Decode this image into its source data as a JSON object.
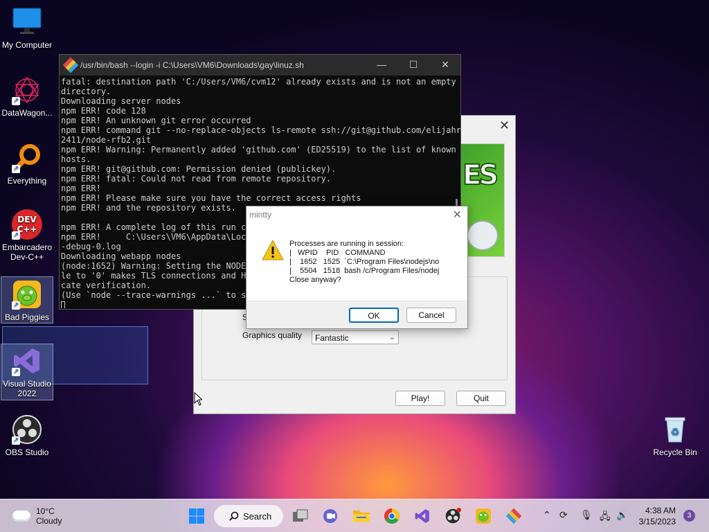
{
  "desktop": {
    "icons": [
      {
        "label": "My Computer"
      },
      {
        "label": "DataWagon..."
      },
      {
        "label": "Everything"
      },
      {
        "label": "Embarcadero Dev-C++"
      },
      {
        "label": "Bad Piggies"
      },
      {
        "label": "Visual Studio 2022"
      },
      {
        "label": "OBS Studio"
      },
      {
        "label": "Recycle Bin"
      }
    ],
    "devcpp_logo_text": "DEV C++"
  },
  "terminal": {
    "title": "/usr/bin/bash --login -i C:\\Users\\VM6\\Downloads\\gay\\linuz.sh",
    "lines": [
      "fatal: destination path 'C:/Users/VM6/cvm12' already exists and is not an empty",
      "directory.",
      "Downloading server nodes",
      "npm ERR! code 128",
      "npm ERR! An unknown git error occurred",
      "npm ERR! command git --no-replace-objects ls-remote ssh://git@github.com/elijahr",
      "2411/node-rfb2.git",
      "npm ERR! Warning: Permanently added 'github.com' (ED25519) to the list of known",
      "hosts.",
      "npm ERR! git@github.com: Permission denied (publickey).",
      "npm ERR! fatal: Could not read from remote repository.",
      "npm ERR!",
      "npm ERR! Please make sure you have the correct access rights",
      "npm ERR! and the repository exists.",
      "",
      "npm ERR! A complete log of this run can",
      "npm ERR!     C:\\Users\\VM6\\AppData\\Loca",
      "-debug-0.log",
      "Downloading webapp nodes",
      "(node:1652) Warning: Setting the NODE_T",
      "le to '0' makes TLS connections and HT",
      "cate verification.",
      "(Use `node --trace-warnings ...` to sho"
    ],
    "cursor_line": ""
  },
  "launcher": {
    "banner_text": "ES",
    "s_label": "S",
    "graphics_quality_label": "Graphics quality",
    "graphics_quality_value": "Fantastic",
    "play_label": "Play!",
    "quit_label": "Quit"
  },
  "dialog": {
    "title": "mintty",
    "message": "Processes are running in session:\n|   WPID    PID   COMMAND\n|    1652   1525  `C:\\Program Files\\nodejs\\no\n|    5504   1518  bash /c/Program Files/nodej\nClose anyway?",
    "ok_label": "OK",
    "cancel_label": "Cancel"
  },
  "taskbar": {
    "weather_temp": "10°C",
    "weather_desc": "Cloudy",
    "search_label": "Search",
    "time": "4:38 AM",
    "date": "3/15/2023",
    "notification_count": "3"
  }
}
